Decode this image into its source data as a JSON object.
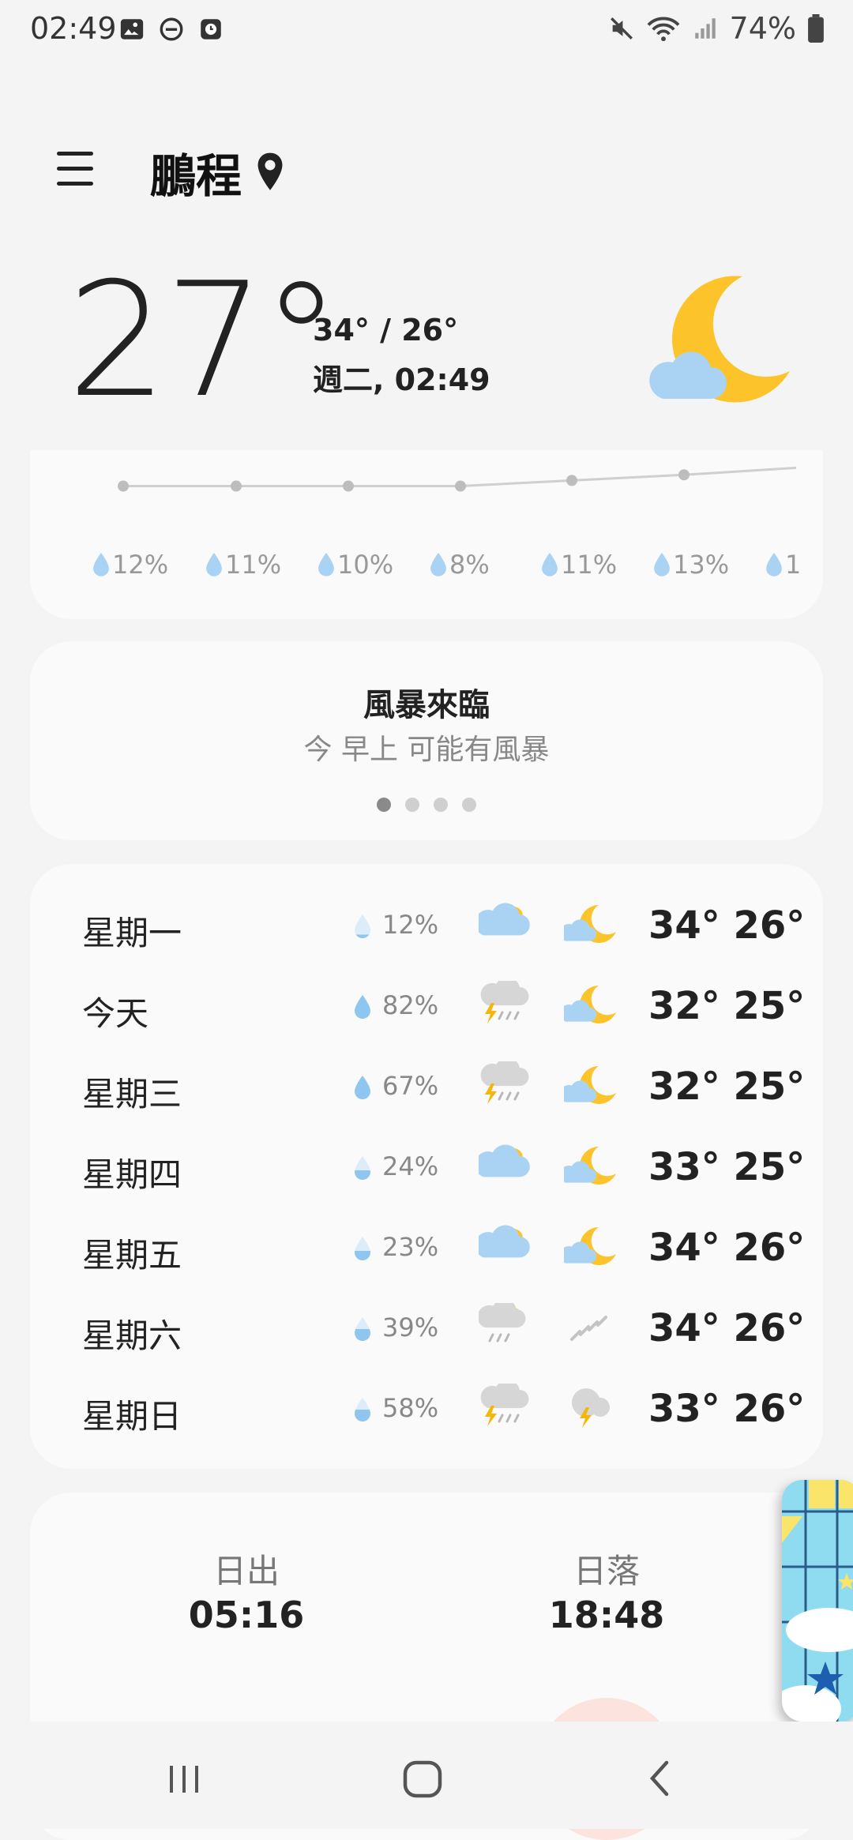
{
  "status_bar": {
    "time": "02:49",
    "left_icons": [
      "image-icon",
      "do-not-disturb-icon",
      "clock-app-icon"
    ],
    "right_icons": [
      "mute-icon",
      "wifi-icon",
      "signal-icon"
    ],
    "battery": "74%"
  },
  "header": {
    "menu_icon": "hamburger-menu-icon",
    "location": "鵬程",
    "location_icon": "location-pin-icon"
  },
  "current": {
    "temperature": "27°",
    "high_low": "34° / 26°",
    "datetime": "週二, 02:49",
    "condition_icon": "moon-cloud-icon"
  },
  "hourly": {
    "precipitation": [
      "12%",
      "11%",
      "10%",
      "8%",
      "11%",
      "13%",
      "1"
    ],
    "line_points": [
      0.16,
      0.16,
      0.16,
      0.16,
      0.12,
      0.08,
      0.03
    ]
  },
  "alert": {
    "title": "風暴來臨",
    "subtitle": "今 早上 可能有風暴",
    "pages": 4,
    "active_page": 0
  },
  "daily": [
    {
      "day": "星期一",
      "precip": "12%",
      "day_icon": "partly-cloudy-icon",
      "night_icon": "moon-cloud-icon",
      "temps": "34° 26°",
      "drop_level": 0.15
    },
    {
      "day": "今天",
      "precip": "82%",
      "day_icon": "thunderstorm-icon",
      "night_icon": "moon-cloud-icon",
      "temps": "32° 25°",
      "drop_level": 1.0
    },
    {
      "day": "星期三",
      "precip": "67%",
      "day_icon": "thunderstorm-icon",
      "night_icon": "moon-cloud-icon",
      "temps": "32° 25°",
      "drop_level": 1.0
    },
    {
      "day": "星期四",
      "precip": "24%",
      "day_icon": "partly-cloudy-icon",
      "night_icon": "moon-cloud-icon",
      "temps": "33° 25°",
      "drop_level": 0.4
    },
    {
      "day": "星期五",
      "precip": "23%",
      "day_icon": "partly-cloudy-icon",
      "night_icon": "moon-cloud-icon",
      "temps": "34° 26°",
      "drop_level": 0.4
    },
    {
      "day": "星期六",
      "precip": "39%",
      "day_icon": "rain-sun-icon",
      "night_icon": "rain-icon",
      "temps": "34° 26°",
      "drop_level": 0.5
    },
    {
      "day": "星期日",
      "precip": "58%",
      "day_icon": "thunderstorm-sun-icon",
      "night_icon": "thunder-cloud-icon",
      "temps": "33° 26°",
      "drop_level": 0.5
    }
  ],
  "sun": {
    "sunrise_label": "日出",
    "sunrise_time": "05:16",
    "sunset_label": "日落",
    "sunset_time": "18:48"
  },
  "nav": {
    "recents": "recents-icon",
    "home": "home-icon",
    "back": "back-icon"
  },
  "colors": {
    "sun_yellow": "#fcc42a",
    "cloud_blue": "#a9d2f3",
    "drop_blue": "#8fc6f0",
    "bolt": "#f5b50a"
  }
}
